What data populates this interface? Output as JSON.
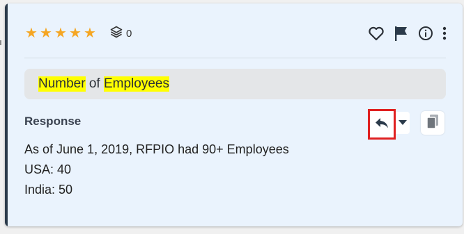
{
  "rating": {
    "stars": 5,
    "icon": "star-icon",
    "color": "#f5a623"
  },
  "layers": {
    "count": "0",
    "icon": "layers-icon"
  },
  "actions": {
    "favorite_icon": "heart-icon",
    "flag_icon": "flag-icon",
    "info_icon": "info-icon",
    "more_icon": "more-vertical-icon"
  },
  "question": {
    "parts": [
      {
        "text": "Number",
        "highlight": true
      },
      {
        "text": " of ",
        "highlight": false
      },
      {
        "text": "Employees",
        "highlight": true
      }
    ]
  },
  "response": {
    "label": "Response",
    "lines": [
      "As of June 1, 2019, RFPIO had 90+ Employees",
      "USA: 40",
      "India: 50"
    ],
    "reply_icon": "reply-icon",
    "dropdown_icon": "caret-down-icon",
    "copy_icon": "copy-icon"
  },
  "colors": {
    "card_bg": "#eaf3fd",
    "accent": "#2b3a4a",
    "highlight": "#ffff00",
    "focus_border": "#e02020"
  }
}
